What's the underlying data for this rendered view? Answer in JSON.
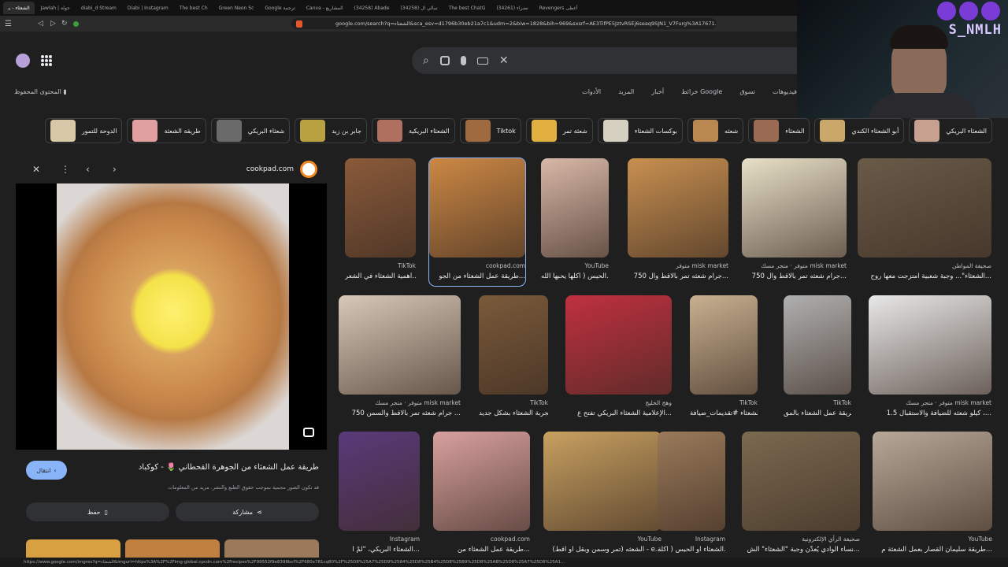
{
  "browser": {
    "tabs": [
      "الشعثاء - بـ",
      "Jawlah | جولة",
      "diabi_d Stream",
      "Diabi | Instagram",
      "The best Ch",
      "Green Neon Sc",
      "Google ترجمة",
      "Canva - المشاريع",
      "(34258) Abade",
      "(34258) سالي ال",
      "The best ChatG",
      "(34261) نضراء",
      "Revengers أعطى"
    ],
    "url": "google.com/search?q=الشعثاء&sca_esv=d1796b30eb21a7c1&udm=2&biw=1828&bih=969&sxsrf=AE3TifPE5JztvRSEj6seaq9SJN1_V7Furg%3A17671..."
  },
  "overlay": {
    "streamer_tag": "S_NMLH"
  },
  "header": {
    "saved_content": "المحتوى المحفوظ",
    "filters": [
      "فيديوهات",
      "تسوق",
      "خرائط Google",
      "أخبار",
      "المزيد",
      "الأدوات"
    ]
  },
  "chips": [
    {
      "label": "الشعثاء البريكي",
      "color": "#c8a090"
    },
    {
      "label": "أبو الشعثاء الكندي",
      "color": "#c9a86a"
    },
    {
      "label": "الشعثاء",
      "color": "#9b6a52"
    },
    {
      "label": "شعثه",
      "color": "#b98850"
    },
    {
      "label": "بوكسات الشعثاء",
      "color": "#d6d0c0"
    },
    {
      "label": "شعثة تمر",
      "color": "#e2b040"
    },
    {
      "label": "Tiktok",
      "color": "#a06a40"
    },
    {
      "label": "الشعثاء البريكية",
      "color": "#b07060"
    },
    {
      "label": "جابر بن زيد",
      "color": "#b9a040"
    },
    {
      "label": "شعثاء البريكي",
      "color": "#6a6a6a"
    },
    {
      "label": "طريقة الشعثة",
      "color": "#e0a0a0"
    },
    {
      "label": "الدوحة للتمور",
      "color": "#d8c8a8"
    }
  ],
  "panel": {
    "source": "cookpad.com",
    "title": "طريقة عمل الشعثاء من الجوهرة القحطاني 🌷 - كوكباد",
    "note": "قد تكون الصور محمية بموجب حقوق الطبع والنشر.  مزيد من المعلومات",
    "visit": "انتقال",
    "save": "حفظ",
    "share": "مشاركة"
  },
  "results": [
    {
      "src": "TikTok",
      "cap": "أهمية الشعثاء في الشعر...",
      "color": "#8a5a3a"
    },
    {
      "src": "cookpad.com",
      "cap": "طريقة عمل الشعثاء من الجو...",
      "color": "#cc8844"
    },
    {
      "src": "YouTube",
      "cap": "الحيس ( أكلها يحبها الله...",
      "color": "#d8b8a8"
    },
    {
      "src": "متوفر  misk market",
      "cap": "750 جرام شعثه تمر بالاقط وال...",
      "color": "#c89050"
    },
    {
      "src": "متوفر  ·  متجر مسك misk market",
      "cap": "750 جرام شعثه تمر بالاقط وال...",
      "color": "#e8e0c8"
    },
    {
      "src": "صحيفة المواطن",
      "cap": "الشعثاء\"... وجبة شعبية امتزجت معها روح...",
      "color": "#6a5a48"
    },
    {
      "src": "متوفر  ·  متجر مسك misk market",
      "cap": "750 جرام شعثه تمر بالاقط والسمن ...",
      "color": "#d8c8b8"
    },
    {
      "src": "TikTok",
      "cap": "تجربة الشعثاء بشكل جديد...",
      "color": "#7a5a3a"
    },
    {
      "src": "وهج الخليج",
      "cap": "الإعلامية الشعثاء البريكي تفتح ع...",
      "color": "#c03040"
    },
    {
      "src": "TikTok",
      "cap": "الشعثاء #تقديمات_ضيافة...",
      "color": "#c8b090"
    },
    {
      "src": "TikTok",
      "cap": "طريقة عمل الشعثاء بالمق...",
      "color": "#b0b0b0"
    },
    {
      "src": "متوفر  ·  متجر مسك misk market",
      "cap": "1.5 كيلو شعثه للضيافة والاستقبال ،...",
      "color": "#e8e8e8"
    },
    {
      "src": "Instagram",
      "cap": "الشعثاء البريكي، \"لَمْ أ...",
      "color": "#5a3a7a"
    },
    {
      "src": "cookpad.com",
      "cap": "طريقة عمل الشعثاء من...",
      "color": "#d8a0a0"
    },
    {
      "src": "YouTube",
      "cap": "الشعثه (تمر وسمن وبقل او اقط) - e...",
      "color": "#c8a060"
    },
    {
      "src": "Instagram",
      "cap": "الشعثاء او الحيس ( اكلة...",
      "color": "#9a7a5a"
    },
    {
      "src": "صحيفة الرأي الإلكترونية",
      "cap": "نساء الوادي يُعدِّن وجبة \"الشعثاء\" الش...",
      "color": "#7a6a50"
    },
    {
      "src": "YouTube",
      "cap": "طريقة سليمان القصار بعمل الشعثة م...",
      "color": "#b8a898"
    }
  ],
  "status_url": "https://www.google.com/imgres?q=الشعثاء&imgurl=https%3A%2F%2Fimg-global.cpcdn.com%2Frecipes%2F99552f9e8398bcf%2F680x781cq80%2F%25D8%25A7%25D9%2584%25D8%25B4%25D8%25B9%25D8%25AB%25D8%25A7%25D8%25A1..."
}
